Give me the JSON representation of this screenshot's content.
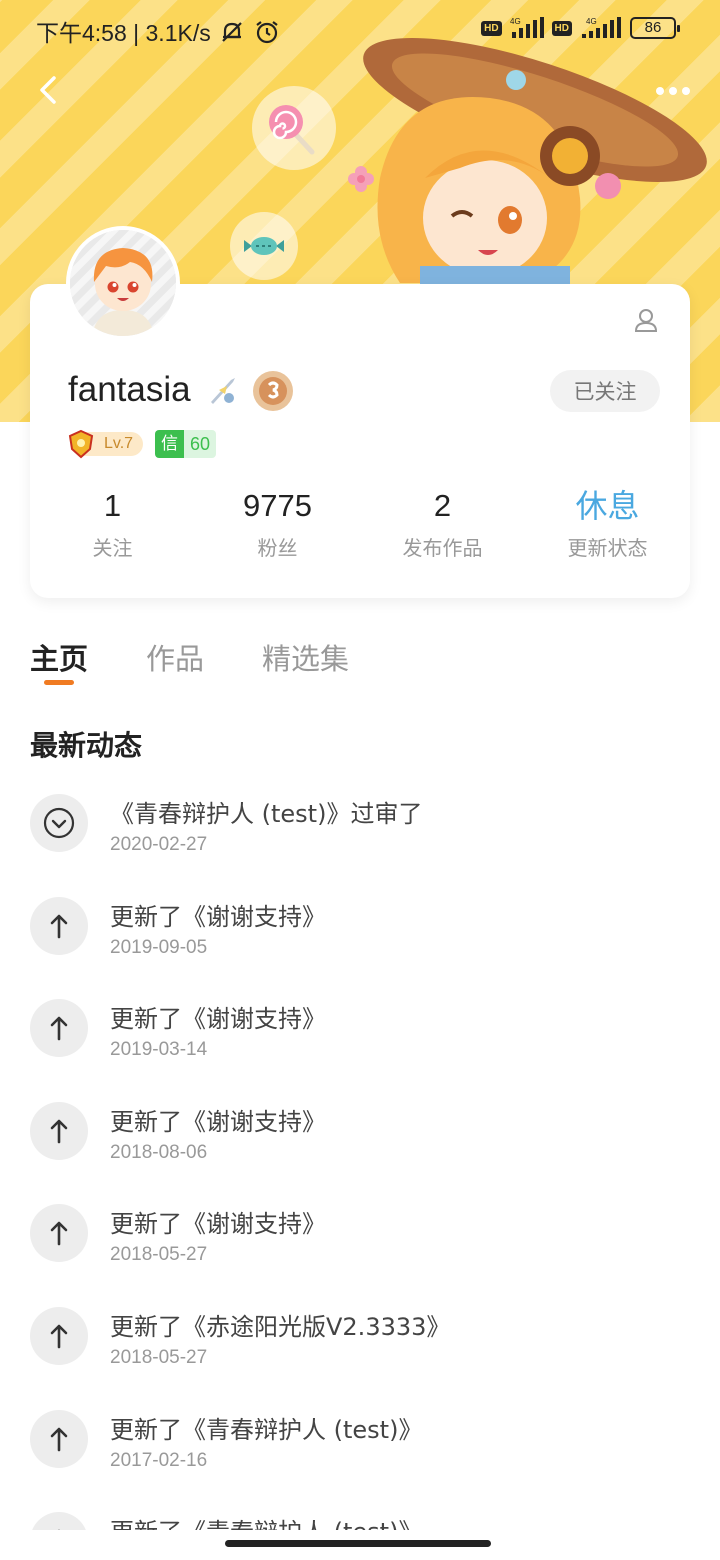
{
  "status_bar": {
    "time_text": "下午4:58 | 3.1K/s",
    "hd1": "HD",
    "net1": "4G",
    "hd2": "HD",
    "net2": "4G",
    "battery": "86"
  },
  "profile": {
    "username": "fantasia",
    "follow_button": "已关注",
    "level": "Lv.7",
    "credit_key": "信",
    "credit_value": "60"
  },
  "stats": [
    {
      "value": "1",
      "label": "关注"
    },
    {
      "value": "9775",
      "label": "粉丝"
    },
    {
      "value": "2",
      "label": "发布作品"
    },
    {
      "value": "休息",
      "label": "更新状态"
    }
  ],
  "tabs": [
    {
      "label": "主页"
    },
    {
      "label": "作品"
    },
    {
      "label": "精选集"
    }
  ],
  "section_title": "最新动态",
  "activities": [
    {
      "icon": "check-circle-icon",
      "text": "《青春辩护人 (test)》过审了",
      "date": "2020-02-27"
    },
    {
      "icon": "arrow-up-icon",
      "text": "更新了《谢谢支持》",
      "date": "2019-09-05"
    },
    {
      "icon": "arrow-up-icon",
      "text": "更新了《谢谢支持》",
      "date": "2019-03-14"
    },
    {
      "icon": "arrow-up-icon",
      "text": "更新了《谢谢支持》",
      "date": "2018-08-06"
    },
    {
      "icon": "arrow-up-icon",
      "text": "更新了《谢谢支持》",
      "date": "2018-05-27"
    },
    {
      "icon": "arrow-up-icon",
      "text": "更新了《赤途阳光版V2.3333》",
      "date": "2018-05-27"
    },
    {
      "icon": "arrow-up-icon",
      "text": "更新了《青春辩护人 (test)》",
      "date": "2017-02-16"
    },
    {
      "icon": "arrow-up-icon",
      "text": "更新了《青春辩护人 (test)》",
      "date": ""
    }
  ],
  "colors": {
    "banner": "#fbd65a",
    "accent_tab": "#f07b22",
    "status_highlight": "#4aa8e0",
    "credit_green": "#3cbf4e"
  }
}
